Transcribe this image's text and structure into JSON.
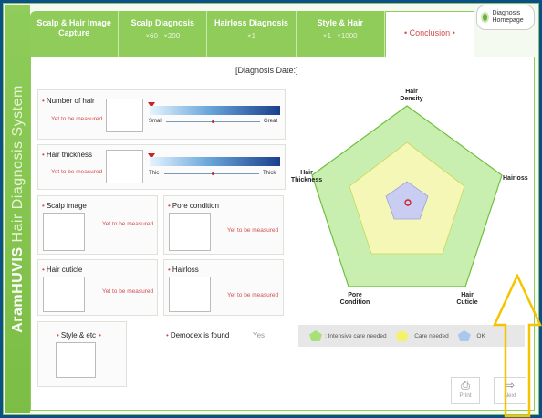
{
  "side_title": {
    "brand": "AramHUVIS",
    "rest": " Hair Diagnosis System"
  },
  "tabs": [
    {
      "label": "Scalp & Hair Image Capture",
      "sub": []
    },
    {
      "label": "Scalp Diagnosis",
      "sub": [
        "×60",
        "×200"
      ]
    },
    {
      "label": "Hairloss Diagnosis",
      "sub": [
        "×1"
      ]
    },
    {
      "label": "Style & Hair",
      "sub": [
        "×1",
        "×1000"
      ]
    },
    {
      "label": "• Conclusion •",
      "sub": []
    }
  ],
  "home_button": {
    "label": "Diagnosis Homepage",
    "icon": "home-circle-icon"
  },
  "diagnosis_date": "[Diagnosis Date:]",
  "panels": {
    "number_of_hair": {
      "label": "Number of hair",
      "status": "Yet to be measured",
      "scale_low": "Small",
      "scale_high": "Great",
      "level": 0.0
    },
    "hair_thickness": {
      "label": "Hair thickness",
      "status": "Yet to be measured",
      "scale_low": "Thic",
      "scale_high": "Thick",
      "level": 0.0
    },
    "scalp_image": {
      "label": "Scalp image",
      "status": "Yet to be measured"
    },
    "pore_condition": {
      "label": "Pore condition",
      "status": "Yet to be measured"
    },
    "hair_cuticle": {
      "label": "Hair cuticle",
      "status": "Yet to be measured"
    },
    "hairloss": {
      "label": "Hairloss",
      "status": "Yet to be measured"
    },
    "style_etc": {
      "label": "Style & etc"
    },
    "demodex": {
      "label": "Demodex is found",
      "value": "Yes"
    }
  },
  "radar": {
    "axes": [
      "Hair Density",
      "Hairloss",
      "Hair Cuticle",
      "Pore Condition",
      "Hair Thickness"
    ],
    "colors": {
      "outer": "#c9efb0",
      "middle": "#f4f7b5",
      "inner": "#c9cdf2",
      "outline": "#6fbf3f"
    }
  },
  "legend": [
    {
      "label": ": Intensive care needed",
      "color": "#a8e07a"
    },
    {
      "label": ": Care needed",
      "color": "#f4f26a"
    },
    {
      "label": ": OK",
      "color": "#a9c8f0"
    }
  ],
  "buttons": {
    "print": "Print",
    "next": "Next"
  }
}
